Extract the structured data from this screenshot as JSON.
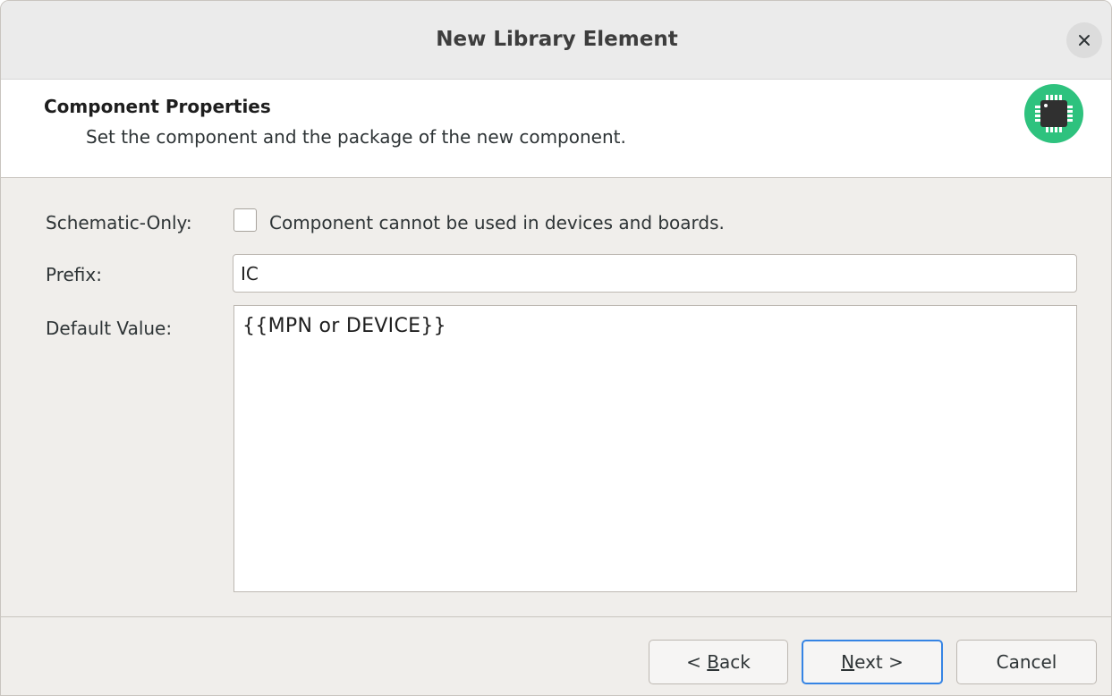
{
  "window": {
    "title": "New Library Element"
  },
  "header": {
    "title": "Component Properties",
    "subtitle": "Set the component and the package of the new component.",
    "icon": "chip-icon",
    "icon_color": "#2ec27e"
  },
  "form": {
    "schematic_only": {
      "label": "Schematic-Only:",
      "checkbox_text": "Component cannot be used in devices and boards.",
      "checked": false
    },
    "prefix": {
      "label": "Prefix:",
      "value": "IC"
    },
    "default_value": {
      "label": "Default Value:",
      "value": "{{MPN or DEVICE}}"
    }
  },
  "buttons": {
    "back": {
      "prefix": "< ",
      "mnemonic": "B",
      "rest": "ack"
    },
    "next": {
      "mnemonic": "N",
      "rest": "ext >"
    },
    "cancel": "Cancel"
  },
  "colors": {
    "accent": "#3584e4",
    "icon_bg": "#2ec27e"
  }
}
